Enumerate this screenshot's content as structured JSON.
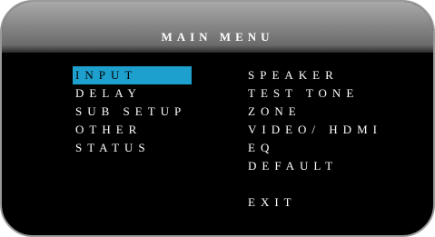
{
  "title": "MAIN MENU",
  "left_menu": [
    {
      "label": "INPUT",
      "selected": true
    },
    {
      "label": "DELAY",
      "selected": false
    },
    {
      "label": "SUB SETUP",
      "selected": false
    },
    {
      "label": "OTHER",
      "selected": false
    },
    {
      "label": "STATUS",
      "selected": false
    }
  ],
  "right_menu": [
    {
      "label": "SPEAKER"
    },
    {
      "label": "TEST TONE"
    },
    {
      "label": "ZONE"
    },
    {
      "label": "VIDEO/ HDMI"
    },
    {
      "label": "EQ"
    },
    {
      "label": "DEFAULT"
    }
  ],
  "exit_label": "EXIT",
  "colors": {
    "highlight": "#1ea0cf",
    "background": "#000000",
    "text": "#ffffff"
  }
}
